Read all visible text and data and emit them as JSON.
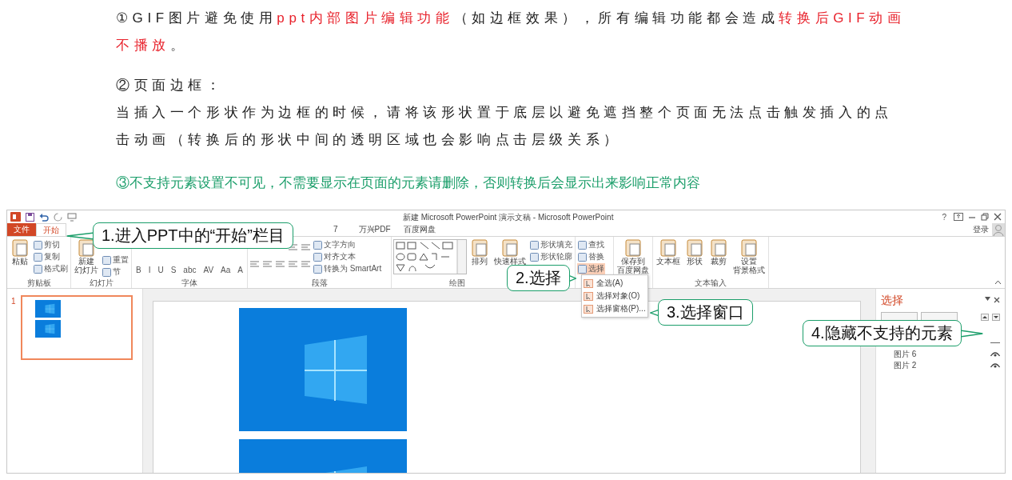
{
  "notes": [
    {
      "kind": "spaced",
      "segments": [
        {
          "text": "①GIF图片避免使用",
          "emphasis": false
        },
        {
          "text": "ppt内部图片编辑功能",
          "emphasis": true
        },
        {
          "text": "（如边框效果），所有编辑功能都会造成",
          "emphasis": false
        },
        {
          "text": "转换后GIF动画不播放",
          "emphasis": true
        },
        {
          "text": "。",
          "emphasis": false
        }
      ]
    },
    {
      "kind": "heading",
      "segments": [
        {
          "text": "②页面边框：",
          "emphasis": false
        }
      ]
    },
    {
      "kind": "spaced",
      "segments": [
        {
          "text": "当插入一个形状作为边框的时候，请将该形状置于底层以避免遮挡整个页面无法点击触发插入的点击动画（转换后的形状中间的透明区域也会影响点击层级关系）",
          "emphasis": false
        }
      ]
    },
    {
      "kind": "tip",
      "segments": [
        {
          "text": "③不支持元素设置不可见，不需要显示在页面的元素请删除，否则转换后会显示出来影响正常内容",
          "emphasis": false
        }
      ]
    }
  ],
  "app": {
    "title": "新建 Microsoft PowerPoint 演示文稿 - Microsoft PowerPoint",
    "help": "?",
    "sign_in": "登录",
    "tabs": [
      {
        "label": "文件",
        "kind": "file",
        "selected": false
      },
      {
        "label": "开始",
        "kind": "tab",
        "selected": true
      },
      {
        "label": "7",
        "kind": "tab",
        "selected": false
      },
      {
        "label": "万兴PDF",
        "kind": "tab",
        "selected": false
      },
      {
        "label": "百度网盘",
        "kind": "tab",
        "selected": false
      }
    ],
    "groups": [
      {
        "label": "剪贴板",
        "columns": [
          [
            {
              "kind": "large",
              "lines": [
                "粘贴"
              ]
            }
          ],
          [
            {
              "kind": "small",
              "label": "剪切"
            },
            {
              "kind": "small",
              "label": "复制"
            },
            {
              "kind": "small",
              "label": "格式刷"
            }
          ]
        ]
      },
      {
        "label": "幻灯片",
        "columns": [
          [
            {
              "kind": "large",
              "lines": [
                "新建",
                "幻灯片"
              ]
            }
          ],
          [
            {
              "kind": "small",
              "label": "重置"
            },
            {
              "kind": "small",
              "label": "节"
            }
          ]
        ]
      },
      {
        "label": "字体",
        "columns": [
          [
            {
              "kind": "row",
              "items": [
                {
                  "kind": "glyph",
                  "label": "B"
                },
                {
                  "kind": "glyph",
                  "label": "I"
                },
                {
                  "kind": "glyph",
                  "label": "U"
                },
                {
                  "kind": "glyph",
                  "label": "S"
                },
                {
                  "kind": "glyph",
                  "label": "abc"
                },
                {
                  "kind": "glyph",
                  "label": "AV"
                },
                {
                  "kind": "glyph",
                  "label": "Aa"
                },
                {
                  "kind": "glyph",
                  "label": "A"
                }
              ]
            }
          ]
        ]
      },
      {
        "label": "段落",
        "columns": [
          [
            {
              "kind": "row",
              "items": [
                {
                  "kind": "icon"
                },
                {
                  "kind": "icon"
                }
              ]
            },
            {
              "kind": "row",
              "items": [
                {
                  "kind": "icon"
                },
                {
                  "kind": "icon"
                },
                {
                  "kind": "icon"
                },
                {
                  "kind": "icon"
                },
                {
                  "kind": "icon"
                }
              ]
            }
          ],
          [
            {
              "kind": "small",
              "label": "文字方向"
            },
            {
              "kind": "small",
              "label": "对齐文本"
            },
            {
              "kind": "small",
              "label": "转换为 SmartArt"
            }
          ]
        ]
      },
      {
        "label": "绘图",
        "columns": [
          [
            {
              "kind": "gallery"
            }
          ],
          [
            {
              "kind": "large",
              "lines": [
                "排列"
              ]
            }
          ],
          [
            {
              "kind": "large",
              "lines": [
                "快速样式"
              ]
            }
          ],
          [
            {
              "kind": "small",
              "label": "形状填充"
            },
            {
              "kind": "small",
              "label": "形状轮廓"
            }
          ]
        ]
      },
      {
        "columns": [
          [
            {
              "kind": "small",
              "label": "查找",
              "open": false
            },
            {
              "kind": "small",
              "label": "替换",
              "open": false
            },
            {
              "kind": "small",
              "label": "选择",
              "open": true
            }
          ]
        ]
      },
      {
        "columns": [
          [
            {
              "kind": "large",
              "lines": [
                "保存到",
                "百度网盘"
              ]
            }
          ]
        ]
      },
      {
        "label": "文本输入",
        "columns": [
          [
            {
              "kind": "large",
              "lines": [
                "文本框"
              ]
            }
          ],
          [
            {
              "kind": "large",
              "lines": [
                "形状"
              ]
            }
          ],
          [
            {
              "kind": "large",
              "lines": [
                "裁剪"
              ]
            }
          ],
          [
            {
              "kind": "large",
              "lines": [
                "设置",
                "背景格式"
              ]
            }
          ]
        ]
      }
    ],
    "menu": [
      "全选(A)",
      "选择对象(O)",
      "选择窗格(P)..."
    ],
    "slide_number": "1",
    "pane": {
      "title": "选择",
      "items": [
        {
          "visible": false
        },
        {
          "label": "图片 6",
          "visible": true
        },
        {
          "label": "图片 2",
          "visible": true
        }
      ]
    }
  },
  "callouts": [
    "1.进入PPT中的“开始”栏目",
    "2.选择",
    "3.选择窗口",
    "4.隐藏不支持的元素"
  ]
}
